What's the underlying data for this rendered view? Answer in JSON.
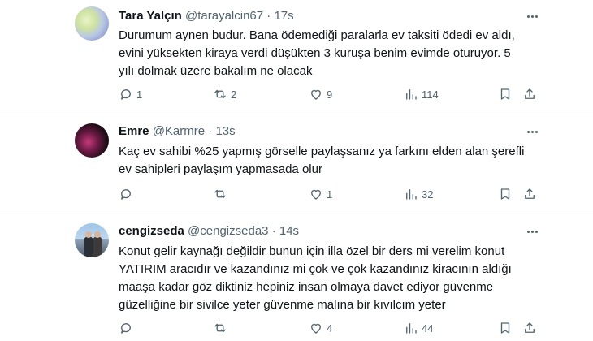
{
  "tweets": [
    {
      "name": "Tara Yalçın",
      "handle": "@tarayalcin67",
      "dot": "·",
      "time": "17s",
      "text": "Durumum aynen budur. Bana ödemediği paralarla ev taksiti ödedi ev aldı,\nevini yüksekten kiraya verdi düşükten 3 kuruşa benim evimde oturuyor. 5\nyılı dolmak üzere bakalım ne olacak",
      "replies": "1",
      "retweets": "2",
      "likes": "9",
      "views": "114"
    },
    {
      "name": "Emre",
      "handle": "@Karmre",
      "dot": "·",
      "time": "13s",
      "text": "Kaç ev sahibi %25 yapmış görselle paylaşsanız ya farkını elden alan şerefli\nev sahipleri paylaşım yapmasada olur",
      "replies": "",
      "retweets": "",
      "likes": "1",
      "views": "32"
    },
    {
      "name": "cengizseda",
      "handle": "@cengizseda3",
      "dot": "·",
      "time": "14s",
      "text": "Konut gelir kaynağı değildir bunun  için illa özel bir ders mi verelim konut\nYATIRIM aracıdır ve kazandınız mi çok ve çok kazandınız kiracının aldığı\nmaaşa kadar göz diktiniz hepiniz insan olmaya davet ediyor güvenme\ngüzelliğine bir sivilce yeter güvenme malına bir kıvılcım yeter",
      "replies": "",
      "retweets": "",
      "likes": "4",
      "views": "44"
    }
  ],
  "icons": {
    "reply": "reply-icon",
    "retweet": "retweet-icon",
    "like": "heart-icon",
    "views": "views-icon",
    "bookmark": "bookmark-icon",
    "share": "share-icon",
    "more": "more-icon"
  }
}
